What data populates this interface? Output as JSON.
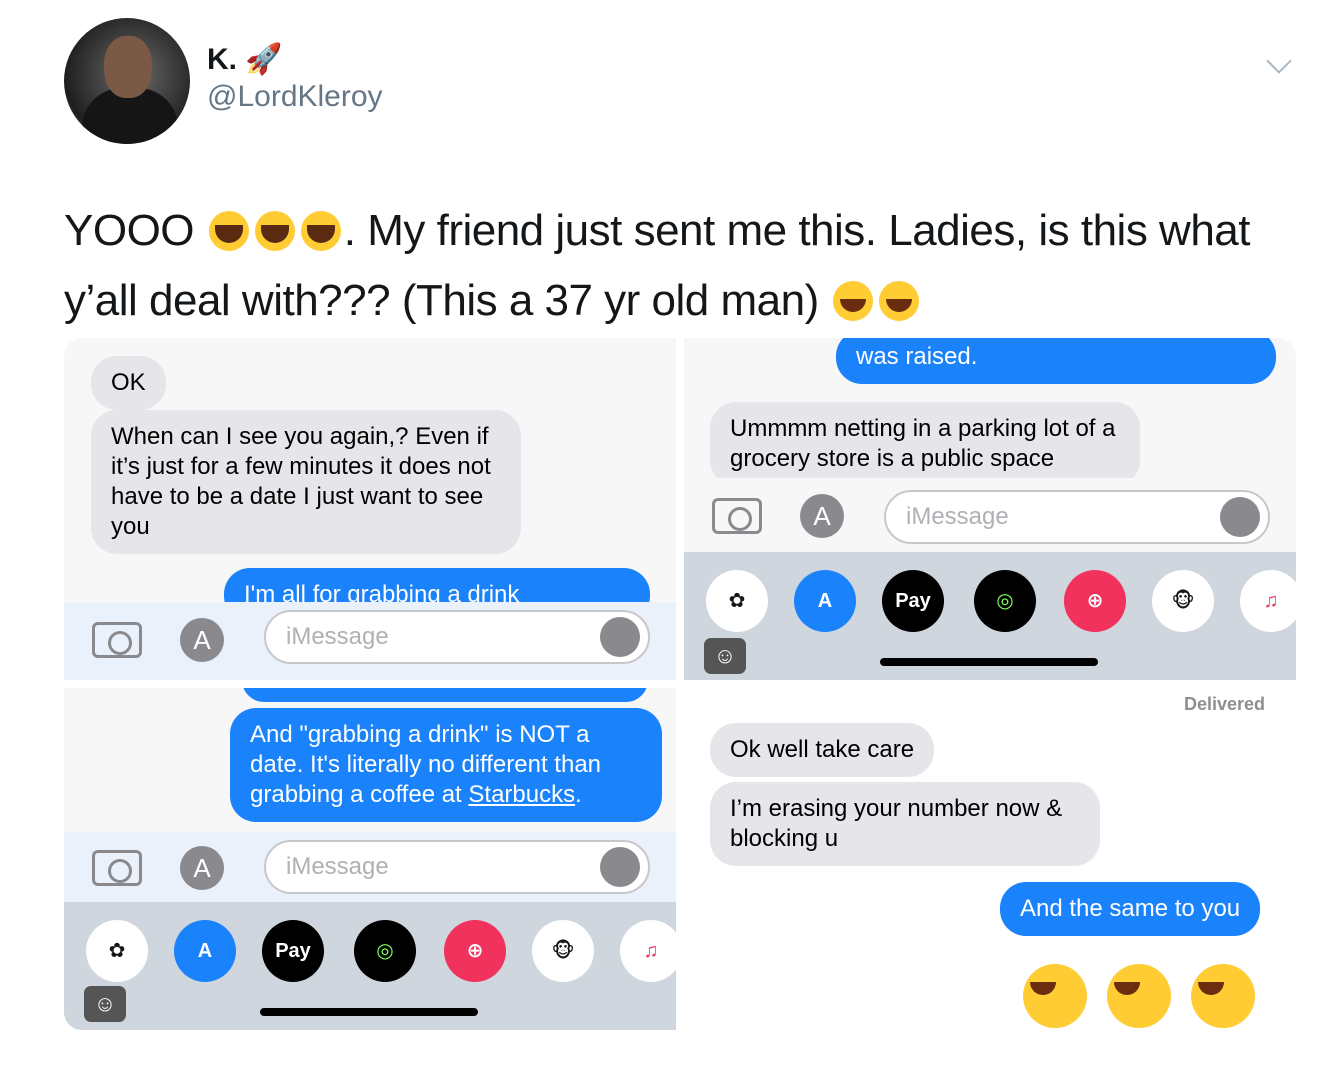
{
  "author": {
    "name": "K. 🚀",
    "handle": "@LordKleroy"
  },
  "tweet": {
    "text_part1": "YOOO",
    "text_part2": ". My friend just sent me this. Ladies, is this what y’all deal with??? (This a 37 yr old man)"
  },
  "panel1": {
    "msg_ok": "OK",
    "msg_when": "When can I see you again,? Even if it’s just for a few minutes it does not have to be a date I just want to see you",
    "msg_partial": "I'm all for grabbing a drink",
    "input_placeholder": "iMessage"
  },
  "panel2": {
    "msg_raised": "was raised.",
    "msg_netting": "Ummmm netting in a parking lot of a grocery store is a public space",
    "input_placeholder": "iMessage",
    "applepay_label": "Pay"
  },
  "panel3": {
    "msg_drink_1": "And \"grabbing a drink\" is NOT a date. It's literally no different than grabbing a coffee at ",
    "msg_drink_link": "Starbucks",
    "msg_drink_end": ".",
    "input_placeholder": "iMessage",
    "applepay_label": "Pay"
  },
  "panel4": {
    "delivered": "Delivered",
    "msg_take_care": "Ok well take care",
    "msg_erasing": "I’m erasing your number now & blocking u",
    "msg_same": "And the same to you"
  },
  "colors": {
    "imessage_blue": "#1a82fb",
    "received_gray": "#e5e5ea",
    "handle_gray": "#657786"
  }
}
